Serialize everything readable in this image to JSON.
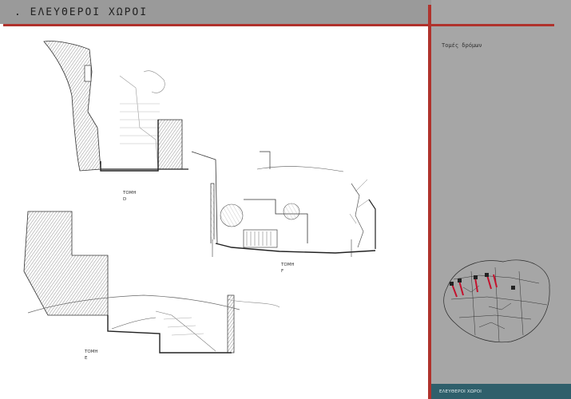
{
  "header": {
    "title": ". ΕΛΕΥΘΕΡΟΙ ΧΩΡΟΙ"
  },
  "sidebar": {
    "subtitle": "Τομές δρόμων"
  },
  "sections": [
    {
      "label": "ΤΟΜΗ",
      "letter": "D"
    },
    {
      "label": "ΤΟΜΗ",
      "letter": "F"
    },
    {
      "label": "ΤΟΜΗ",
      "letter": "E"
    }
  ],
  "footer": {
    "text": "ΕΛΕΥΘΕΡΟΙ ΧΩΡΟΙ"
  },
  "colors": {
    "accent_red": "#b0322c",
    "sidebar_gray": "#a6a6a6",
    "footer_teal": "#2f5f6b"
  }
}
